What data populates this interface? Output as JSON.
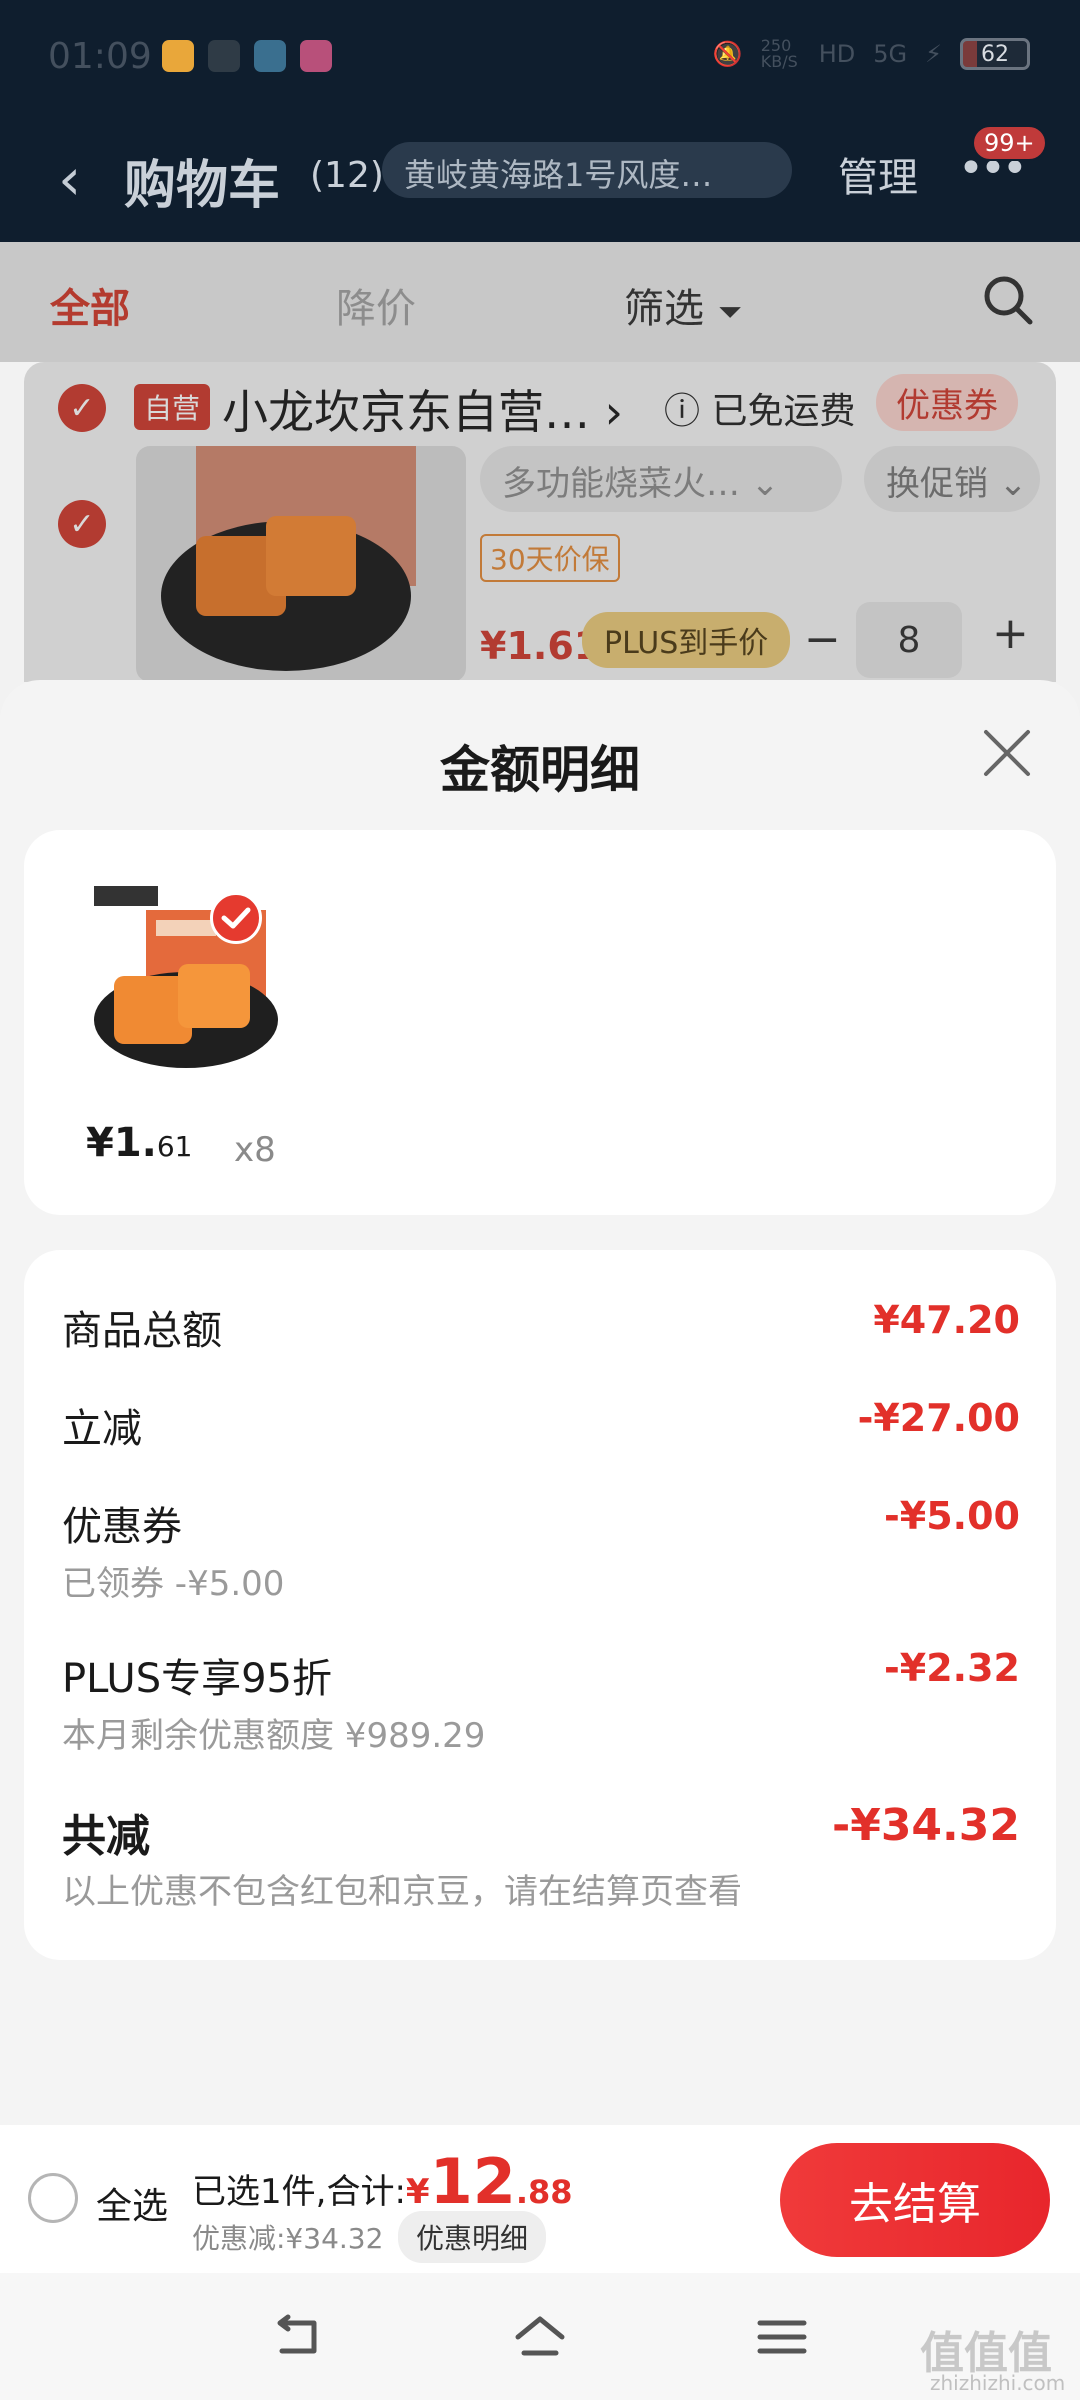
{
  "status_bar": {
    "time": "01:09",
    "net_speed": "250 KB/S",
    "network": "HD",
    "signal": "5G",
    "battery": "62"
  },
  "nav": {
    "title": "购物车",
    "count": "(12)",
    "address": "黄岐黄海路1号风度…",
    "manage": "管理",
    "badge": "99+"
  },
  "tabs": {
    "all": "全部",
    "price_drop": "降价",
    "filter": "筛选"
  },
  "cart_item": {
    "self_run_tag": "自营",
    "shop_name": "小龙坎京东自营…",
    "free_shipping": "已免运费",
    "coupon_tag": "优惠券",
    "spec": "多功能烧菜火…",
    "promo": "换促销",
    "price_protect": "30天价保",
    "price": "¥1.61",
    "plus_tag": "PLUS到手价",
    "qty_minus": "−",
    "qty": "8",
    "qty_plus": "+"
  },
  "sheet": {
    "title": "金额明细",
    "item": {
      "price_int": "¥1.",
      "price_dec": "61",
      "qty": "x8"
    },
    "rows": [
      {
        "label": "商品总额",
        "value": "¥47.20"
      },
      {
        "label": "立减",
        "value": "-¥27.00"
      },
      {
        "label": "优惠券",
        "sub": "已领券 -¥5.00",
        "value": "-¥5.00"
      },
      {
        "label": "PLUS专享95折",
        "sub": "本月剩余优惠额度 ¥989.29",
        "value": "-¥2.32"
      },
      {
        "label": "共减",
        "sub": "以上优惠不包含红包和京豆，请在结算页查看",
        "value": "-¥34.32"
      }
    ]
  },
  "checkout": {
    "select_all": "全选",
    "summary_prefix": "已选1件,合计:",
    "currency": "¥",
    "total_int": "12",
    "total_dec": ".88",
    "saved": "优惠减:¥34.32",
    "detail_button": "优惠明细",
    "submit": "去结算"
  },
  "watermark": {
    "main": "值值值",
    "sub": "zhizhizhi.com"
  },
  "colors": {
    "accent": "#e2302a",
    "nav_bg": "#0f1e2e",
    "sheet_bg": "#f4f4f4"
  }
}
